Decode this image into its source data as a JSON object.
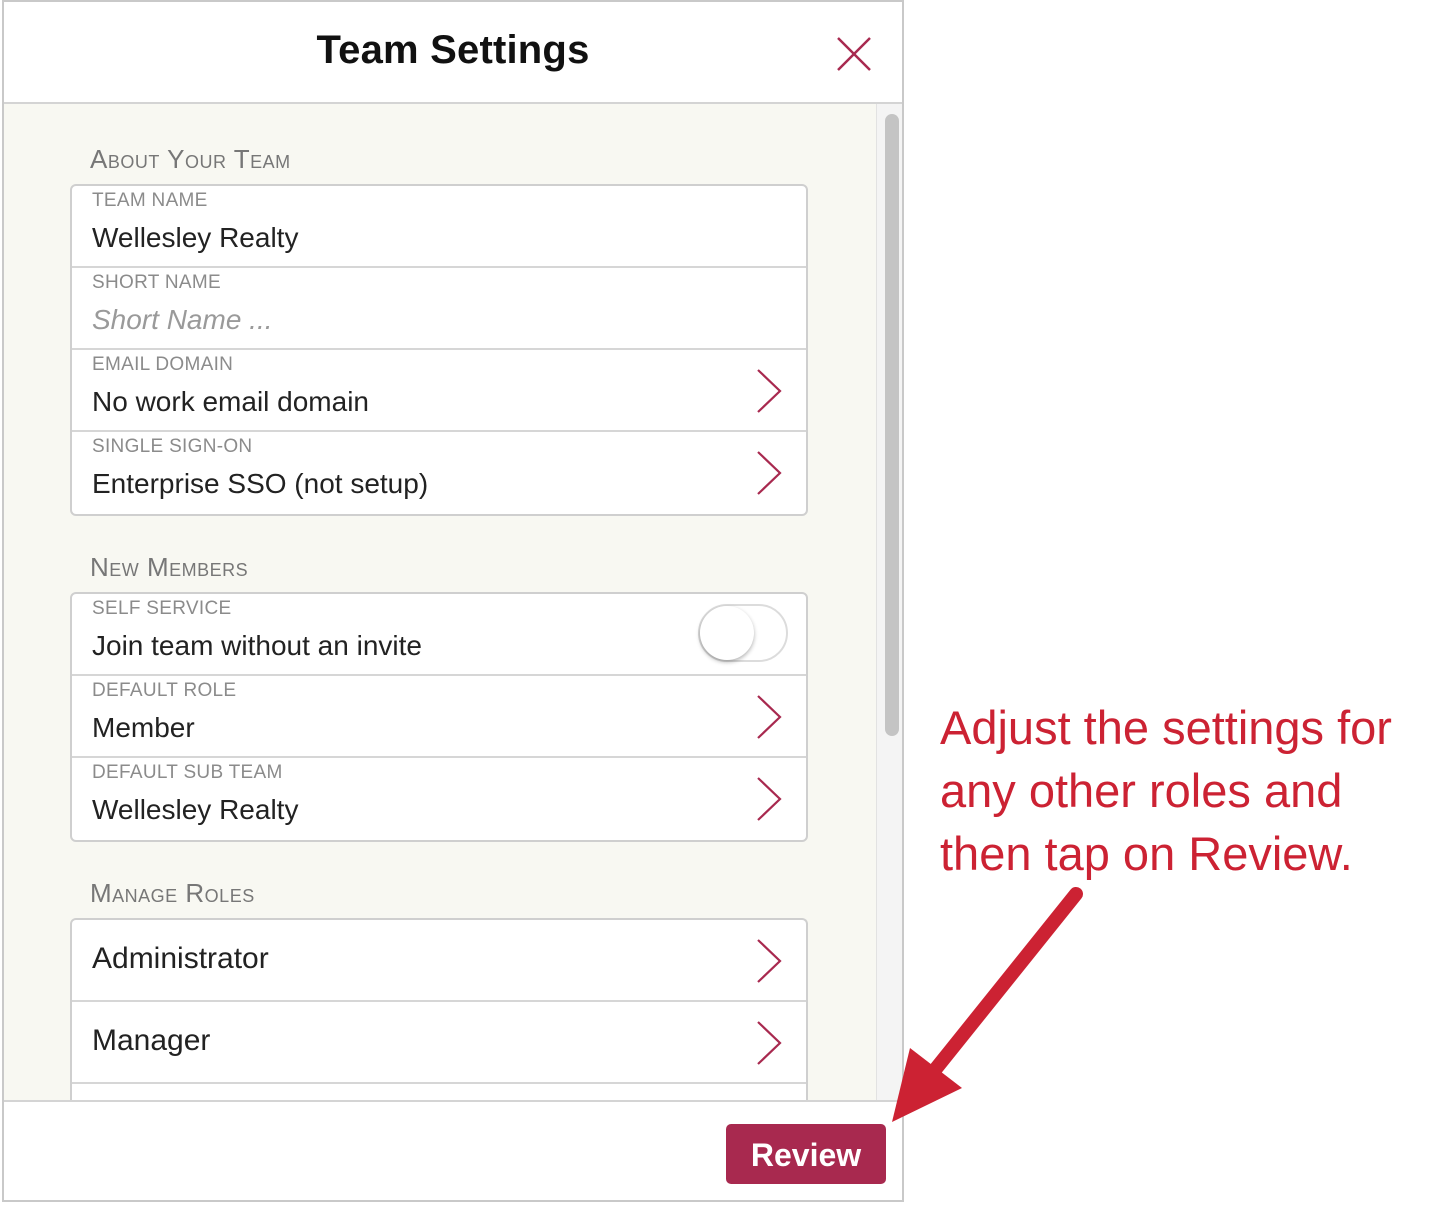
{
  "modal": {
    "title": "Team Settings"
  },
  "sections": {
    "about": {
      "header": "About Your Team",
      "team_name": {
        "label": "TEAM NAME",
        "value": "Wellesley Realty"
      },
      "short_name": {
        "label": "SHORT NAME",
        "placeholder": "Short Name ..."
      },
      "email_domain": {
        "label": "EMAIL DOMAIN",
        "value": "No work email domain"
      },
      "sso": {
        "label": "SINGLE SIGN-ON",
        "value": "Enterprise SSO (not setup)"
      }
    },
    "new_members": {
      "header": "New Members",
      "self_service": {
        "label": "SELF SERVICE",
        "value": "Join team without an invite",
        "enabled": false
      },
      "default_role": {
        "label": "DEFAULT ROLE",
        "value": "Member"
      },
      "default_sub_team": {
        "label": "DEFAULT SUB TEAM",
        "value": "Wellesley Realty"
      }
    },
    "roles": {
      "header": "Manage Roles",
      "items": [
        {
          "label": "Administrator"
        },
        {
          "label": "Manager"
        }
      ]
    }
  },
  "footer": {
    "review_label": "Review"
  },
  "annotation": {
    "text": "Adjust the settings for any other roles and then tap on Review."
  },
  "colors": {
    "accent": "#a8294f",
    "annotation": "#cc2233",
    "panel_bg": "#f8f8f2"
  },
  "icons": {
    "close": "close-icon",
    "chevron": "chevron-right-icon"
  }
}
